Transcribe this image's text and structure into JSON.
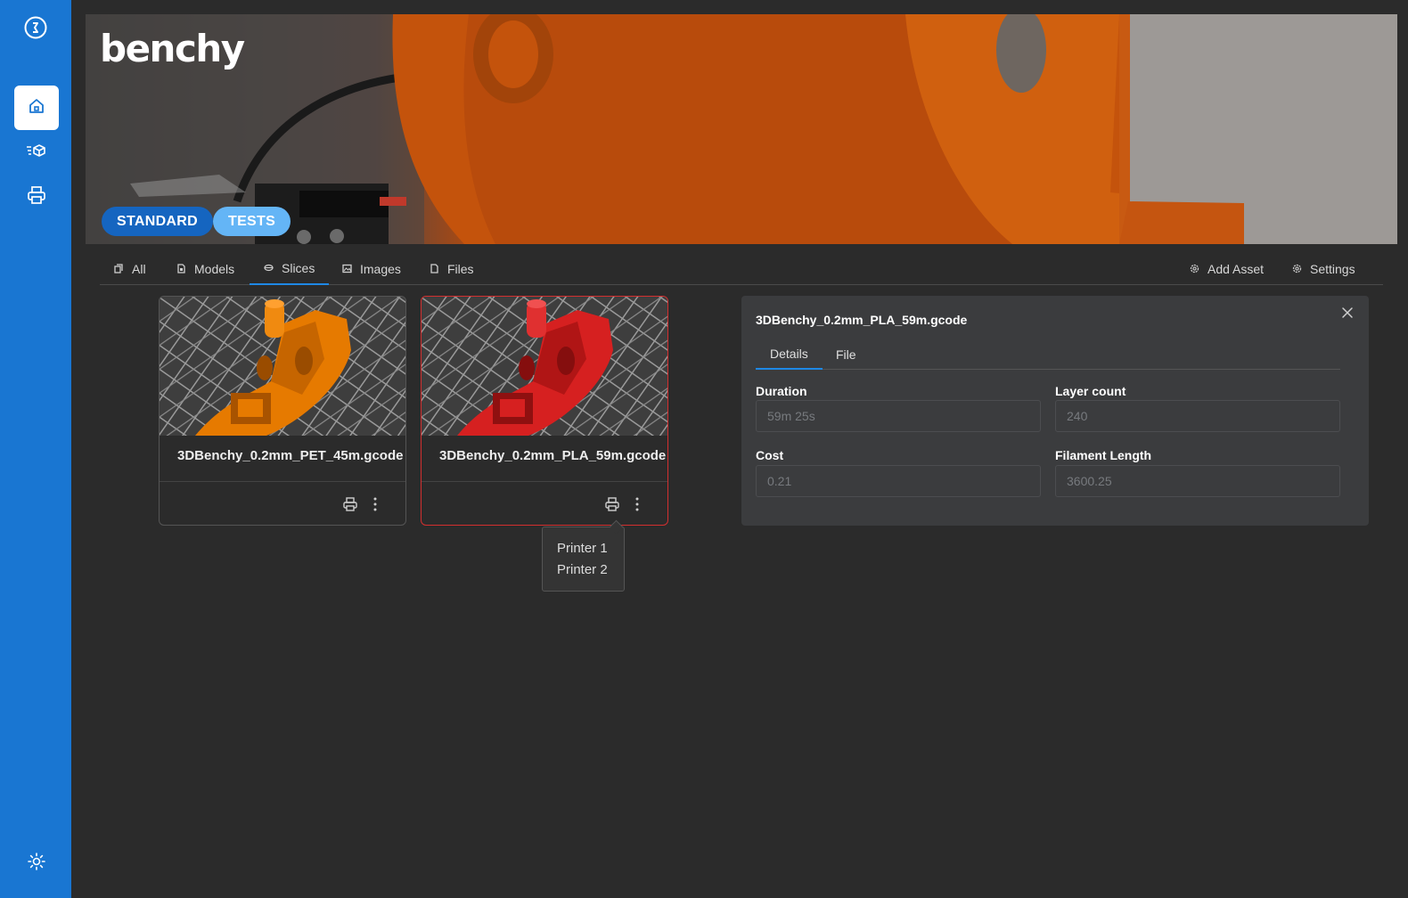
{
  "app": {
    "accent_color": "#1976d2",
    "selected_color": "#d32f2f"
  },
  "sidebar": {
    "logo_icon": "logo-icon",
    "items": [
      {
        "name": "home",
        "icon": "home-icon",
        "active": true
      },
      {
        "name": "models",
        "icon": "cube-list-icon",
        "active": false
      },
      {
        "name": "printers",
        "icon": "printer-icon",
        "active": false
      }
    ],
    "theme_icon": "sun-icon"
  },
  "banner": {
    "title": "benchy",
    "tags": [
      "STANDARD",
      "TESTS"
    ]
  },
  "tabs": {
    "all": "All",
    "models": "Models",
    "slices": "Slices",
    "images": "Images",
    "files": "Files",
    "add_asset": "Add Asset",
    "settings": "Settings",
    "active": "Slices"
  },
  "slices": [
    {
      "name": "3DBenchy_0.2mm_PET_45m.gcode",
      "color": "#e67a00",
      "selected": false
    },
    {
      "name": "3DBenchy_0.2mm_PLA_59m.gcode",
      "color": "#d62020",
      "selected": true
    }
  ],
  "printer_menu": {
    "items": [
      "Printer 1",
      "Printer 2"
    ]
  },
  "detail": {
    "title": "3DBenchy_0.2mm_PLA_59m.gcode",
    "tabs": [
      "Details",
      "File"
    ],
    "active_tab": "Details",
    "fields": {
      "duration": {
        "label": "Duration",
        "value": "59m 25s"
      },
      "layer_count": {
        "label": "Layer count",
        "value": "240"
      },
      "cost": {
        "label": "Cost",
        "value": "0.21"
      },
      "filament_length": {
        "label": "Filament Length",
        "value": "3600.25"
      }
    }
  }
}
